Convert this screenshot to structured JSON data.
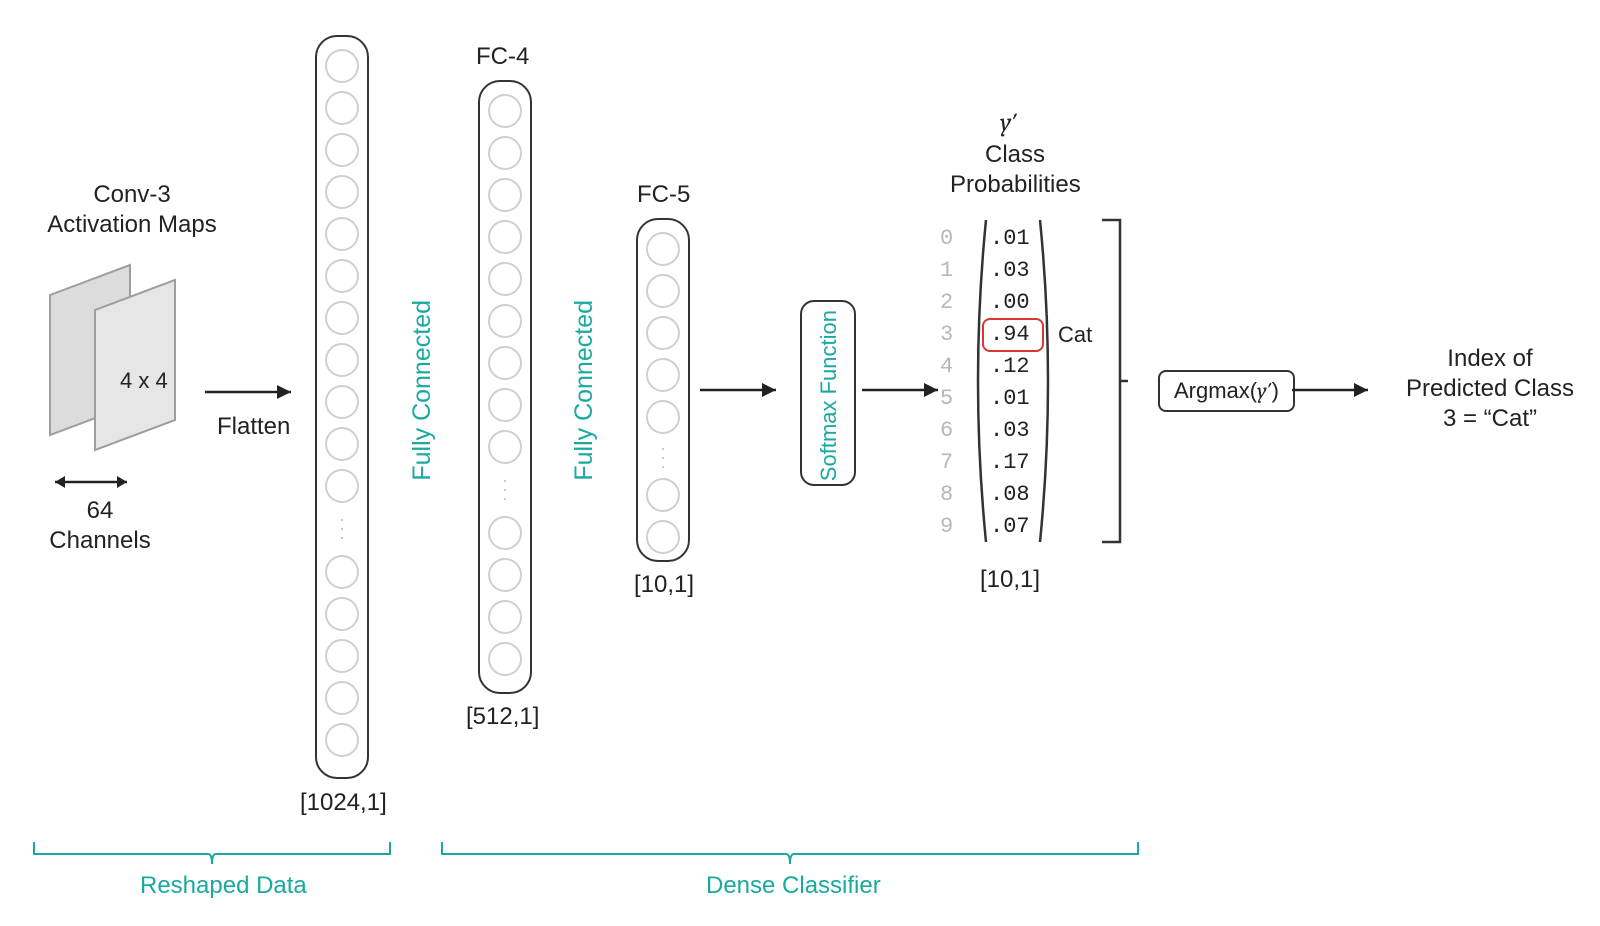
{
  "conv3_title": "Conv-3\nActivation Maps",
  "conv3_dims": "4 x 4",
  "channels_label": "64\nChannels",
  "flatten_label": "Flatten",
  "vec1_title": "",
  "vec1_shape": "[1024,1]",
  "fc4_title": "FC-4",
  "fc4_shape": "[512,1]",
  "fc5_title": "FC-5",
  "fc5_shape": "[10,1]",
  "fc_label_1": "Fully Connected",
  "fc_label_2": "Fully Connected",
  "softmax_label": "Softmax Function",
  "yprime": "y′",
  "class_prob_title": "Class\nProbabilities",
  "probs": {
    "indices": [
      "0",
      "1",
      "2",
      "3",
      "4",
      "5",
      "6",
      "7",
      "8",
      "9"
    ],
    "values": [
      ".01",
      ".03",
      ".00",
      ".94",
      ".12",
      ".01",
      ".03",
      ".17",
      ".08",
      ".07"
    ],
    "highlight_index": 3,
    "highlight_label": "Cat",
    "shape": "[10,1]"
  },
  "argmax_label": "Argmax(y′)",
  "output_title": "Index of\nPredicted Class\n3 = “Cat”",
  "section_left": "Reshaped Data",
  "section_right": "Dense Classifier"
}
